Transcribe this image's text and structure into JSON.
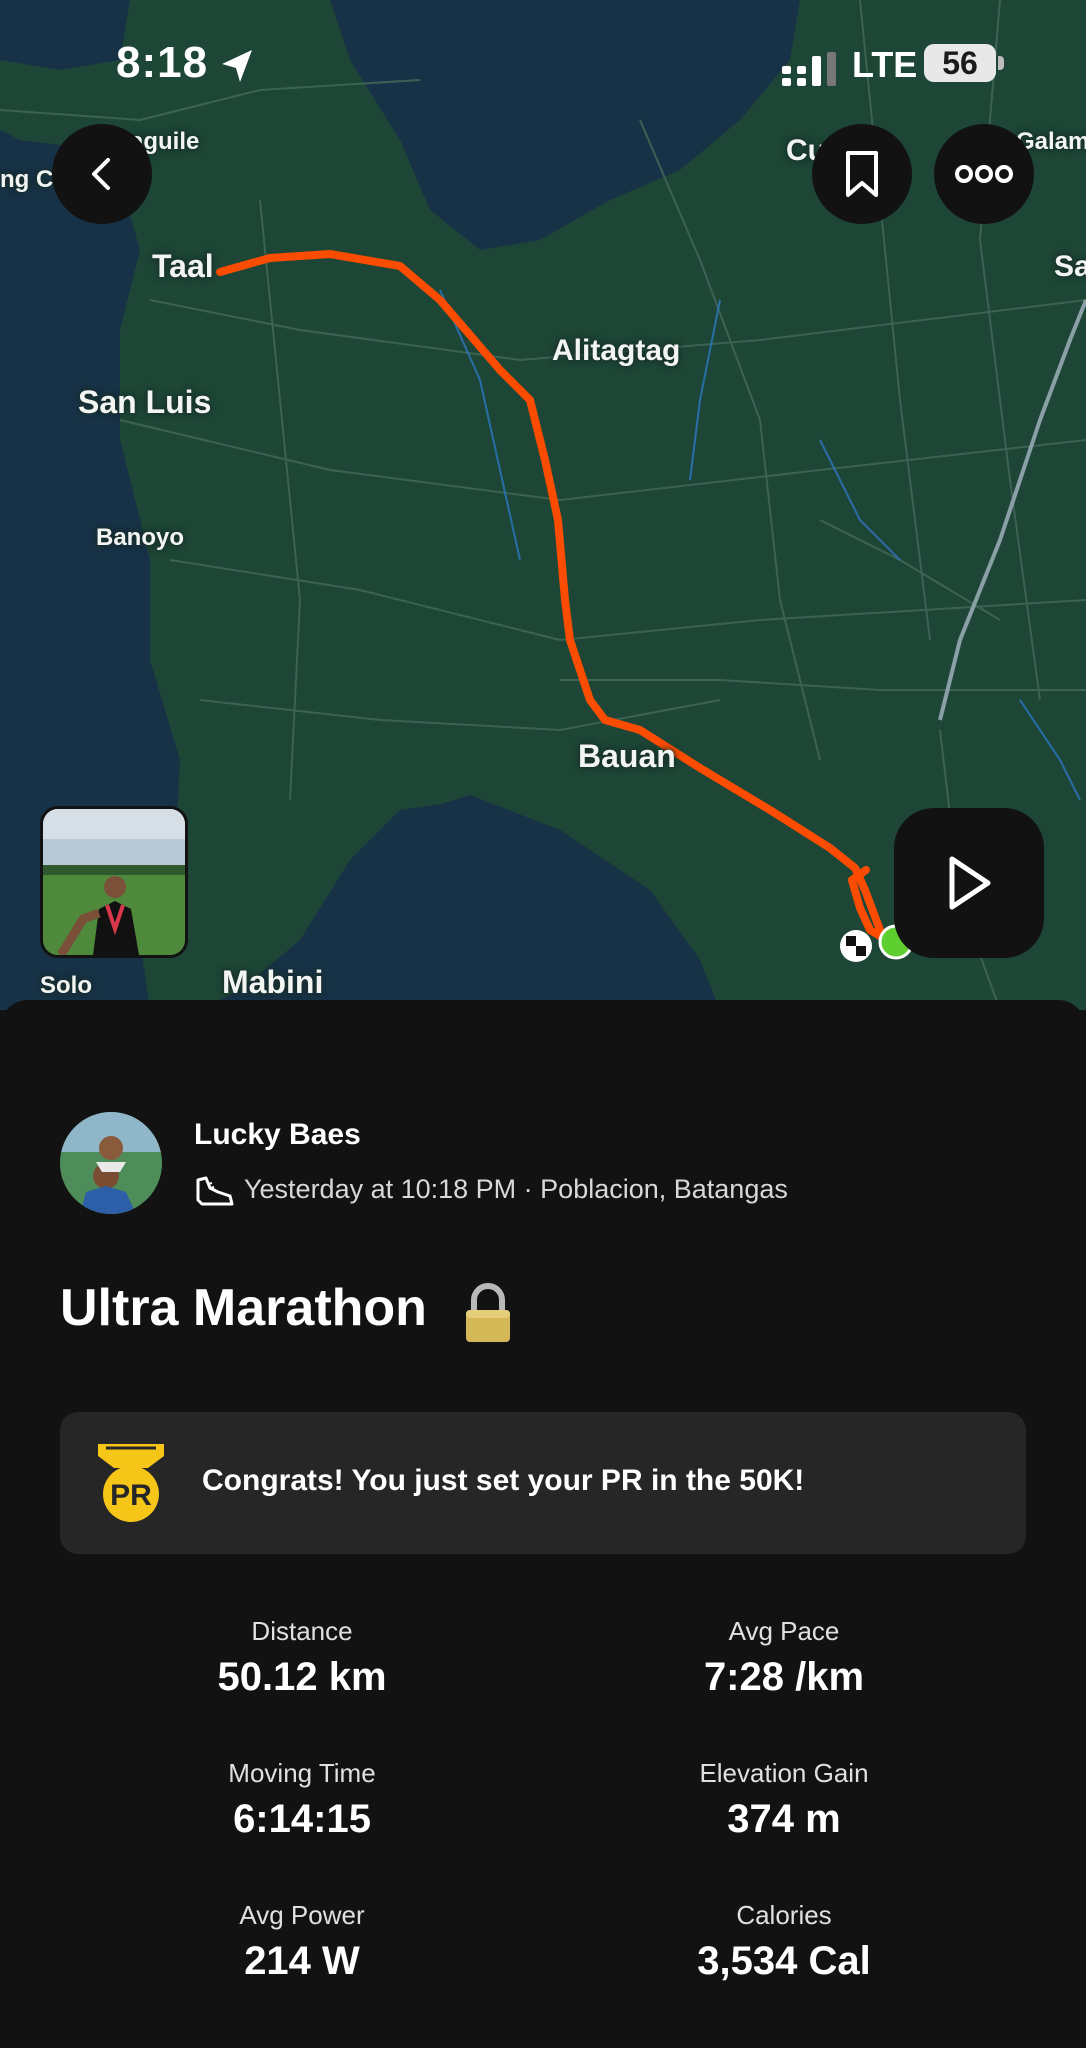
{
  "status_bar": {
    "time": "8:18",
    "network": "LTE",
    "battery": "56"
  },
  "map": {
    "places": {
      "taal": "Taal",
      "san_luis": "San Luis",
      "banoyo": "Banoyo",
      "alitagtag": "Alitagtag",
      "bauan": "Bauan",
      "mabini": "Mabini",
      "solo": "Solo",
      "aguile": "aguile",
      "ng_c": "ng C",
      "cu": "Cu",
      "galam": "Galam",
      "sa": "Sa"
    },
    "colors": {
      "route": "#fc4c02",
      "land": "#1d4636",
      "water": "#173247",
      "start": "#5fcf2f"
    }
  },
  "activity": {
    "athlete": "Lucky Baes",
    "meta": "Yesterday at 10:18 PM · Poblacion, Batangas",
    "title": "Ultra Marathon",
    "pr_message": "Congrats! You just set your PR in the 50K!",
    "stats": [
      {
        "label": "Distance",
        "value": "50.12 km"
      },
      {
        "label": "Avg Pace",
        "value": "7:28 /km"
      },
      {
        "label": "Moving Time",
        "value": "6:14:15"
      },
      {
        "label": "Elevation Gain",
        "value": "374 m"
      },
      {
        "label": "Avg Power",
        "value": "214 W"
      },
      {
        "label": "Calories",
        "value": "3,534 Cal"
      }
    ]
  },
  "icons": {
    "back": "chevron-left-icon",
    "bookmark": "bookmark-icon",
    "more": "more-options-icon",
    "play": "play-icon",
    "sport": "running-shoe-icon",
    "lock": "lock-icon",
    "pr": "pr-medal-icon"
  }
}
